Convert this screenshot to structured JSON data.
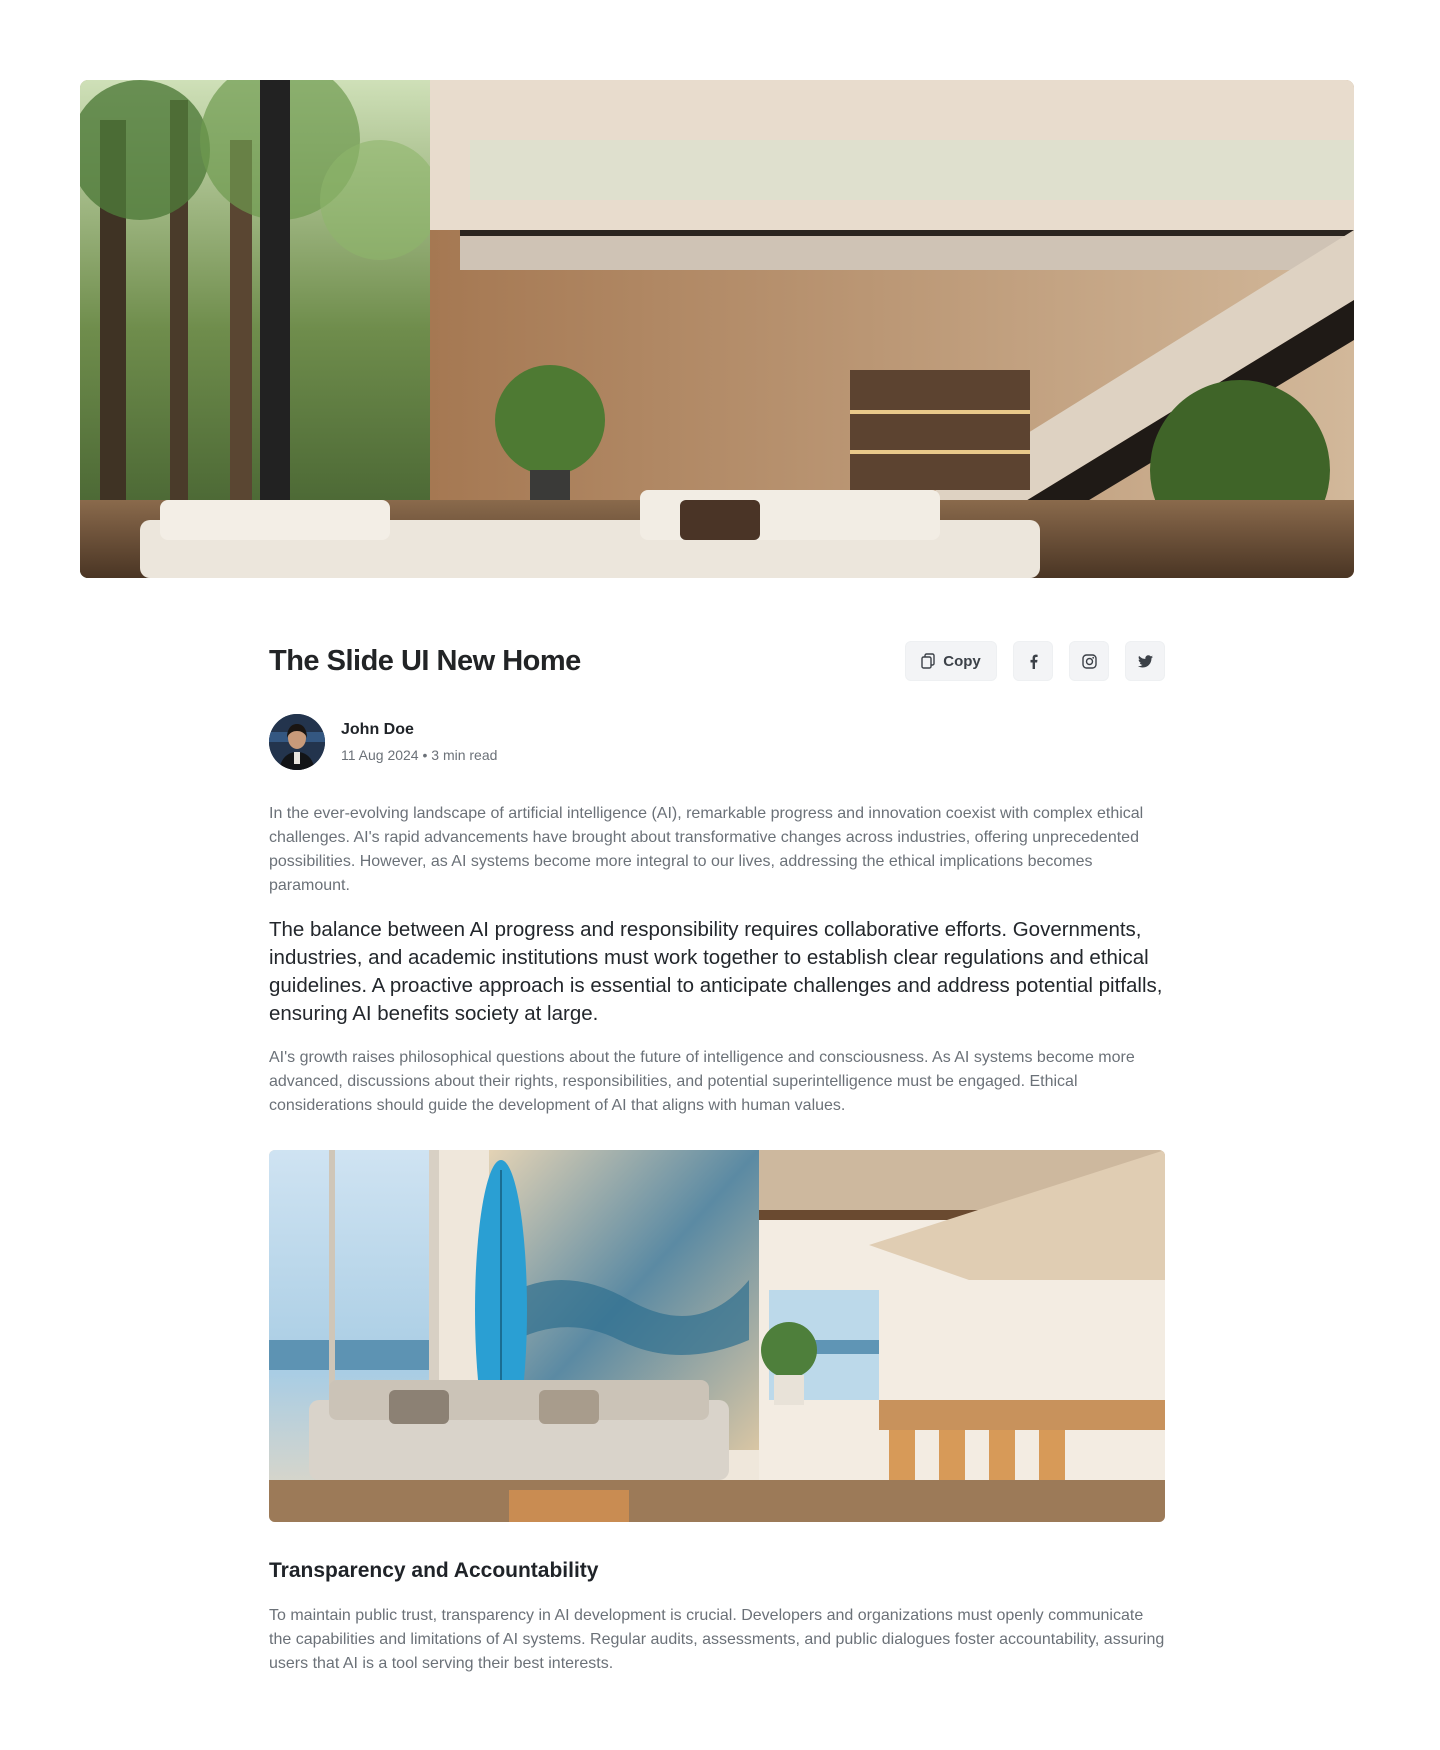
{
  "hero": {
    "image_alt": "Modern two-storey living room with floating wooden staircase, glass balcony and garden view"
  },
  "post": {
    "title": "The Slide UI New Home",
    "copy_label": "Copy"
  },
  "share": {
    "icons": [
      "copy-icon",
      "facebook-icon",
      "instagram-icon",
      "twitter-icon"
    ]
  },
  "author": {
    "name": "John Doe",
    "meta": "11 Aug 2024 • 3 min read"
  },
  "body": {
    "intro": "In the ever-evolving landscape of artificial intelligence (AI), remarkable progress and innovation coexist with complex ethical challenges. AI's rapid advancements have brought about transformative changes across industries, offering unprecedented possibilities. However, as AI systems become more integral to our lives, addressing the ethical implications becomes paramount.",
    "lead": "The balance between AI progress and responsibility requires collaborative efforts. Governments, industries, and academic institutions must work together to establish clear regulations and ethical guidelines. A proactive approach is essential to anticipate challenges and address potential pitfalls, ensuring AI benefits society at large.",
    "paragraph2": "AI's growth raises philosophical questions about the future of intelligence and consciousness. As AI systems become more advanced, discussions about their rights, responsibilities, and potential superintelligence must be engaged. Ethical considerations should guide the development of AI that aligns with human values.",
    "inline_image_alt": "Beach house living room with blue surfboard, sofa and dining area",
    "subheading": "Transparency and Accountability",
    "paragraph3": "To maintain public trust, transparency in AI development is crucial. Developers and organizations must openly communicate the capabilities and limitations of AI systems. Regular audits, assessments, and public dialogues foster accountability, assuring users that AI is a tool serving their best interests."
  },
  "colors": {
    "text_primary": "#1f2328",
    "text_muted": "#6b7178",
    "button_bg": "#f3f4f6"
  }
}
